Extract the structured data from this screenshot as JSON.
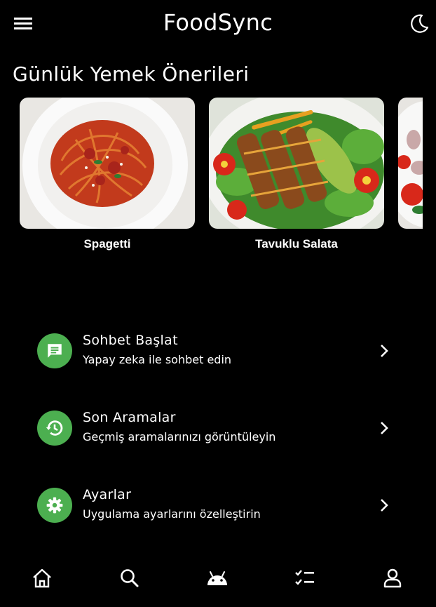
{
  "app": {
    "title": "FoodSync"
  },
  "header": {
    "menu_icon": "menu-icon",
    "theme_icon": "moon-icon"
  },
  "suggestions": {
    "title": "Günlük Yemek Önerileri",
    "items": [
      {
        "label": "Spagetti"
      },
      {
        "label": "Tavuklu Salata"
      },
      {
        "label": ""
      }
    ]
  },
  "menu": {
    "items": [
      {
        "title": "Sohbet Başlat",
        "subtitle": "Yapay zeka ile sohbet edin",
        "icon": "chat-icon"
      },
      {
        "title": "Son Aramalar",
        "subtitle": "Geçmiş aramalarınızı görüntüleyin",
        "icon": "history-icon"
      },
      {
        "title": "Ayarlar",
        "subtitle": "Uygulama ayarlarını özelleştirin",
        "icon": "settings-icon"
      }
    ]
  },
  "bottom_nav": {
    "items": [
      {
        "icon": "home-icon"
      },
      {
        "icon": "search-icon"
      },
      {
        "icon": "android-icon"
      },
      {
        "icon": "checklist-icon"
      },
      {
        "icon": "profile-icon"
      }
    ]
  },
  "colors": {
    "accent": "#4caf50",
    "background": "#000000",
    "text": "#ffffff"
  }
}
